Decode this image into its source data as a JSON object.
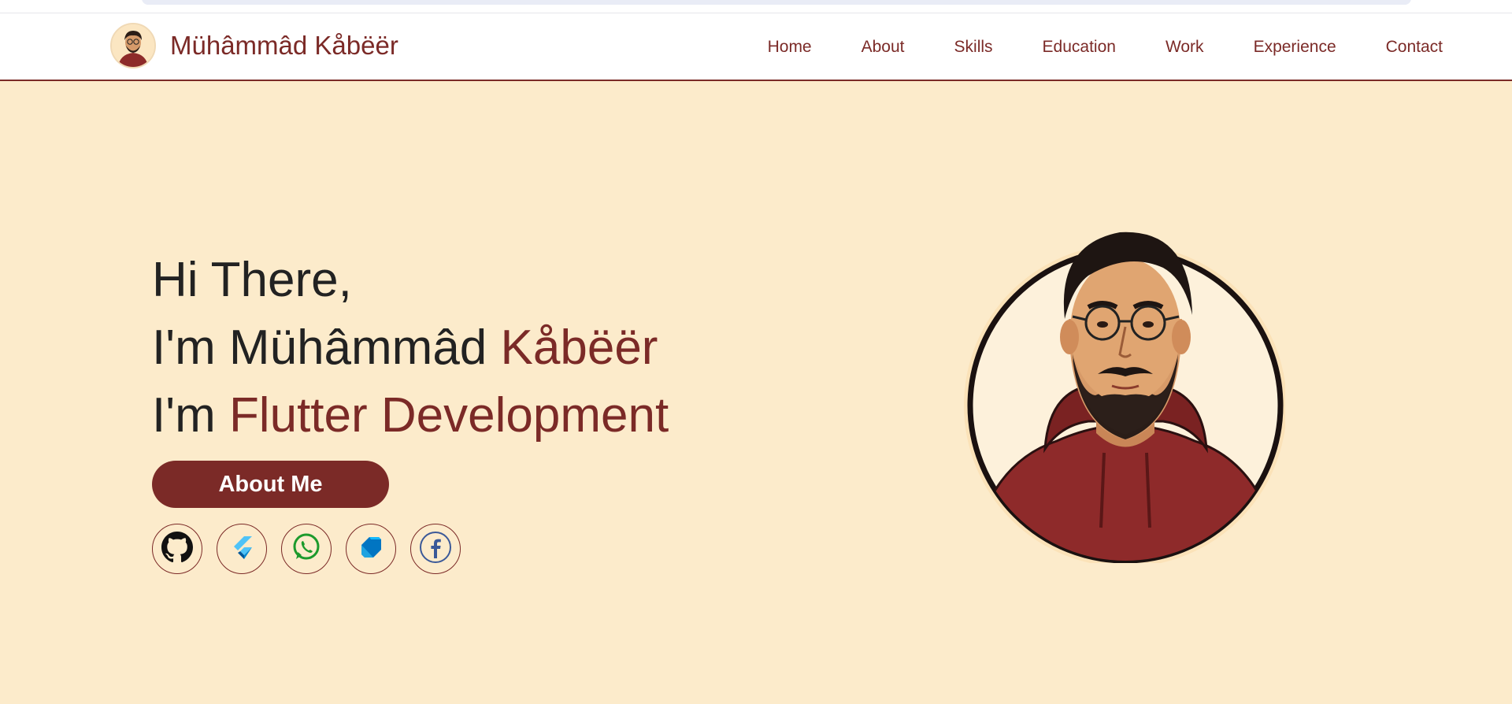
{
  "header": {
    "brand_name": "Mühâmmâd Kåbëër",
    "nav": [
      {
        "label": "Home"
      },
      {
        "label": "About"
      },
      {
        "label": "Skills"
      },
      {
        "label": "Education"
      },
      {
        "label": "Work"
      },
      {
        "label": "Experience"
      },
      {
        "label": "Contact"
      }
    ]
  },
  "hero": {
    "greeting": "Hi There,",
    "intro_prefix": "I'm Mühâmmâd ",
    "intro_name_accent": "Kåbëër",
    "role_prefix": "I'm ",
    "role_accent": "Flutter Development",
    "about_button_label": "About Me"
  },
  "socials": [
    {
      "icon": "github-icon"
    },
    {
      "icon": "flutter-icon"
    },
    {
      "icon": "whatsapp-icon"
    },
    {
      "icon": "dart-icon"
    },
    {
      "icon": "facebook-icon"
    }
  ],
  "colors": {
    "accent": "#7b2a27",
    "hero_background": "#fcebcb",
    "text_dark": "#222222"
  }
}
